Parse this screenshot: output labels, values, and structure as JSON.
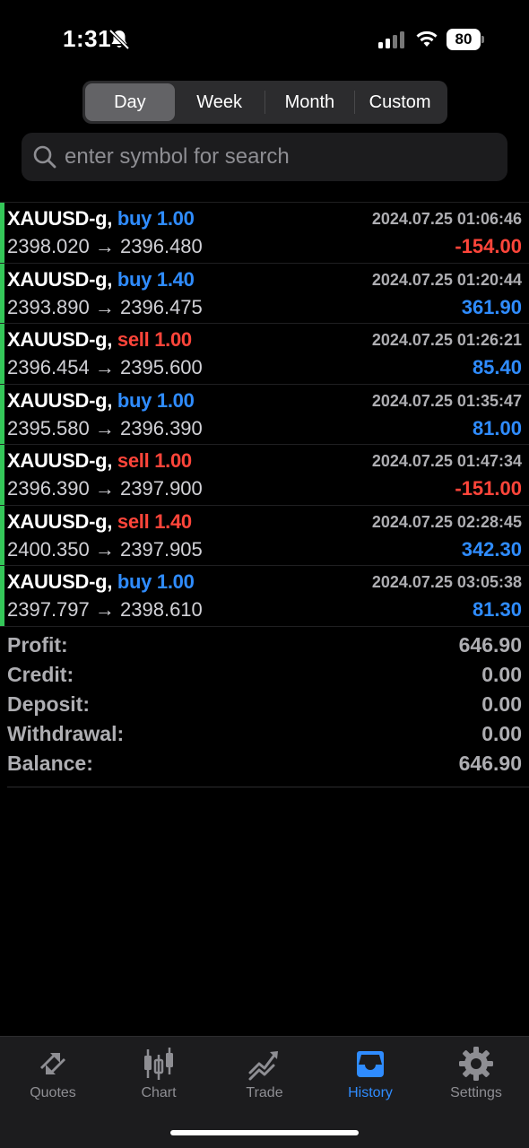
{
  "status_bar": {
    "time": "1:31",
    "battery": "80",
    "icons": [
      "bell-slash-icon",
      "signal-icon",
      "wifi-icon",
      "battery-icon"
    ]
  },
  "segments": [
    {
      "label": "Day",
      "active": true
    },
    {
      "label": "Week",
      "active": false
    },
    {
      "label": "Month",
      "active": false
    },
    {
      "label": "Custom",
      "active": false
    }
  ],
  "search": {
    "placeholder": "enter symbol for search"
  },
  "deals": [
    {
      "symbol": "XAUUSD-g,",
      "side": "buy",
      "volume": "1.00",
      "open": "2398.020",
      "arrow": "→",
      "close": "2396.480",
      "time": "2024.07.25 01:06:46",
      "profit": "-154.00"
    },
    {
      "symbol": "XAUUSD-g,",
      "side": "buy",
      "volume": "1.40",
      "open": "2393.890",
      "arrow": "→",
      "close": "2396.475",
      "time": "2024.07.25 01:20:44",
      "profit": "361.90"
    },
    {
      "symbol": "XAUUSD-g,",
      "side": "sell",
      "volume": "1.00",
      "open": "2396.454",
      "arrow": "→",
      "close": "2395.600",
      "time": "2024.07.25 01:26:21",
      "profit": "85.40"
    },
    {
      "symbol": "XAUUSD-g,",
      "side": "buy",
      "volume": "1.00",
      "open": "2395.580",
      "arrow": "→",
      "close": "2396.390",
      "time": "2024.07.25 01:35:47",
      "profit": "81.00"
    },
    {
      "symbol": "XAUUSD-g,",
      "side": "sell",
      "volume": "1.00",
      "open": "2396.390",
      "arrow": "→",
      "close": "2397.900",
      "time": "2024.07.25 01:47:34",
      "profit": "-151.00"
    },
    {
      "symbol": "XAUUSD-g,",
      "side": "sell",
      "volume": "1.40",
      "open": "2400.350",
      "arrow": "→",
      "close": "2397.905",
      "time": "2024.07.25 02:28:45",
      "profit": "342.30"
    },
    {
      "symbol": "XAUUSD-g,",
      "side": "buy",
      "volume": "1.00",
      "open": "2397.797",
      "arrow": "→",
      "close": "2398.610",
      "time": "2024.07.25 03:05:38",
      "profit": "81.30"
    }
  ],
  "summary": [
    {
      "label": "Profit:",
      "value": "646.90"
    },
    {
      "label": "Credit:",
      "value": "0.00"
    },
    {
      "label": "Deposit:",
      "value": "0.00"
    },
    {
      "label": "Withdrawal:",
      "value": "0.00"
    },
    {
      "label": "Balance:",
      "value": "646.90"
    }
  ],
  "tabs": [
    {
      "label": "Quotes",
      "icon": "quotes-icon",
      "active": false
    },
    {
      "label": "Chart",
      "icon": "chart-icon",
      "active": false
    },
    {
      "label": "Trade",
      "icon": "trade-icon",
      "active": false
    },
    {
      "label": "History",
      "icon": "history-icon",
      "active": true
    },
    {
      "label": "Settings",
      "icon": "settings-icon",
      "active": false
    }
  ],
  "colors": {
    "buy": "#2f8cff",
    "sell": "#ff453a",
    "marker": "#34c759",
    "accent": "#2f8cff"
  }
}
